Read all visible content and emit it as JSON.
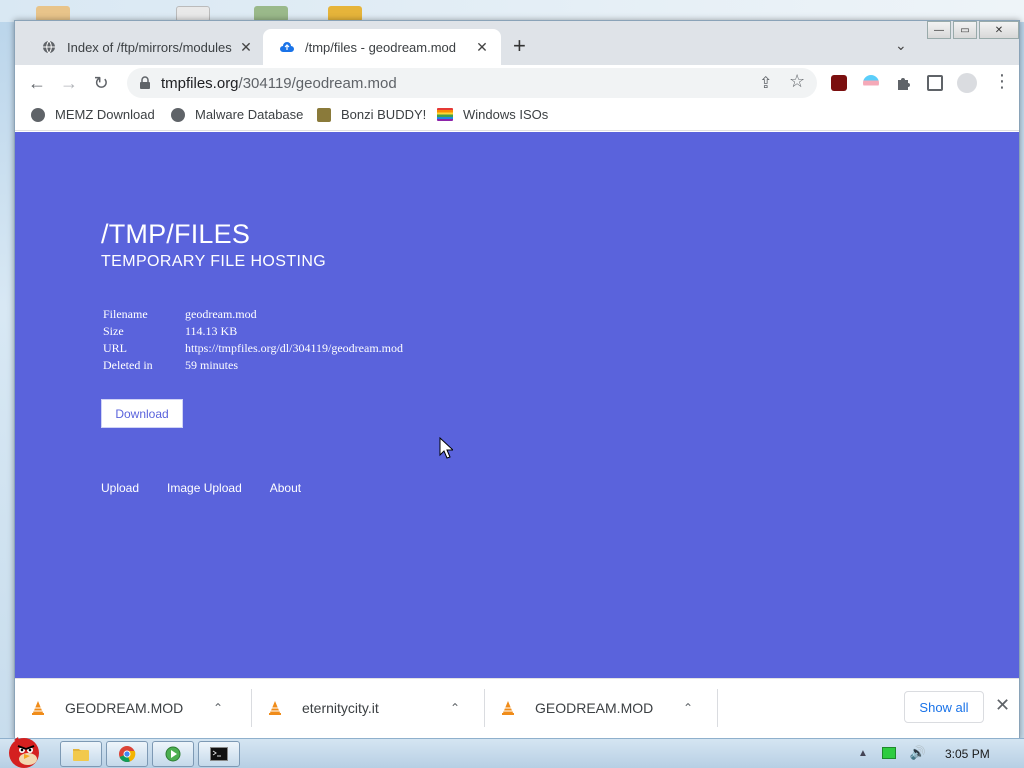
{
  "browser": {
    "tabs": [
      {
        "title": "Index of /ftp/mirrors/modules",
        "active": false
      },
      {
        "title": "/tmp/files - geodream.mod",
        "active": true
      }
    ],
    "new_tab": "+",
    "close_glyph": "✕",
    "tab_menu": "⌄",
    "window_controls": {
      "minimize": "—",
      "maximize": "▭",
      "close": "✕"
    },
    "address": {
      "host": "tmpfiles.org",
      "path": "/304119/geodream.mod"
    },
    "nav": {
      "back": "←",
      "forward": "→",
      "reload": "↻"
    },
    "omnibox_icons": {
      "share": "⇪",
      "star": "☆"
    },
    "menu": "⋮",
    "bookmarks": [
      {
        "label": "MEMZ Download",
        "icon": "globe-icon"
      },
      {
        "label": "Malware Database",
        "icon": "globe-icon"
      },
      {
        "label": "Bonzi BUDDY!",
        "icon": "bonzi-icon"
      },
      {
        "label": "Windows ISOs",
        "icon": "windows-flag-icon"
      }
    ]
  },
  "page": {
    "title": "/TMP/FILES",
    "subtitle": "TEMPORARY FILE HOSTING",
    "info": [
      {
        "key": "Filename",
        "value": "geodream.mod"
      },
      {
        "key": "Size",
        "value": "114.13 KB"
      },
      {
        "key": "URL",
        "value": "https://tmpfiles.org/dl/304119/geodream.mod"
      },
      {
        "key": "Deleted in",
        "value": "59 minutes"
      }
    ],
    "download_button": "Download",
    "footer_links": [
      "Upload",
      "Image Upload",
      "About"
    ],
    "background_color": "#5a63dc"
  },
  "downloads_bar": {
    "items": [
      "GEODREAM.MOD",
      "eternitycity.it",
      "GEODREAM.MOD"
    ],
    "chevron": "⌃",
    "show_all": "Show all",
    "close": "✕"
  },
  "taskbar": {
    "clock": "3:05 PM"
  }
}
